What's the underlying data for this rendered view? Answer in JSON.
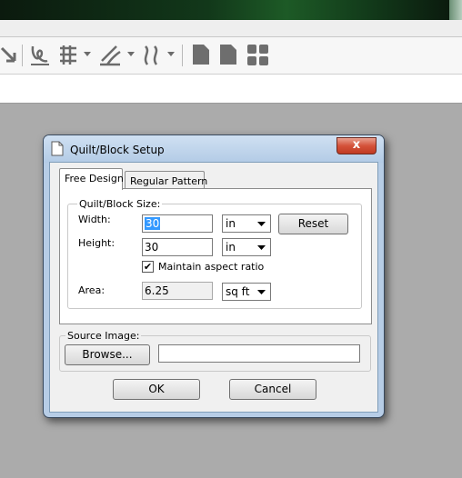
{
  "dialog": {
    "title": "Quilt/Block Setup",
    "close_glyph": "x",
    "tabs": [
      {
        "label": "Free Design",
        "active": true
      },
      {
        "label": "Regular Pattern",
        "active": false
      }
    ],
    "size_group": {
      "legend": "Quilt/Block Size:",
      "width_label": "Width:",
      "width_value": "30",
      "width_unit": "in",
      "height_label": "Height:",
      "height_value": "30",
      "height_unit": "in",
      "reset_label": "Reset",
      "maintain_label": "Maintain aspect ratio",
      "maintain_checked": true,
      "check_glyph": "✔",
      "area_label": "Area:",
      "area_value": "6.25",
      "area_unit": "sq ft"
    },
    "source_group": {
      "legend": "Source Image:",
      "browse_label": "Browse...",
      "path_value": ""
    },
    "ok_label": "OK",
    "cancel_label": "Cancel"
  },
  "toolbar_icons": [
    "arrow-icon",
    "lasso-icon",
    "grid-icon",
    "brush-icon",
    "stitch-icon",
    "page-icon",
    "page-icon",
    "thumbnails-icon"
  ],
  "colors": {
    "workspace": "#ababab",
    "dialog_frame": "#b7cde6",
    "close_button": "#c8452c",
    "selection": "#3399ff"
  }
}
